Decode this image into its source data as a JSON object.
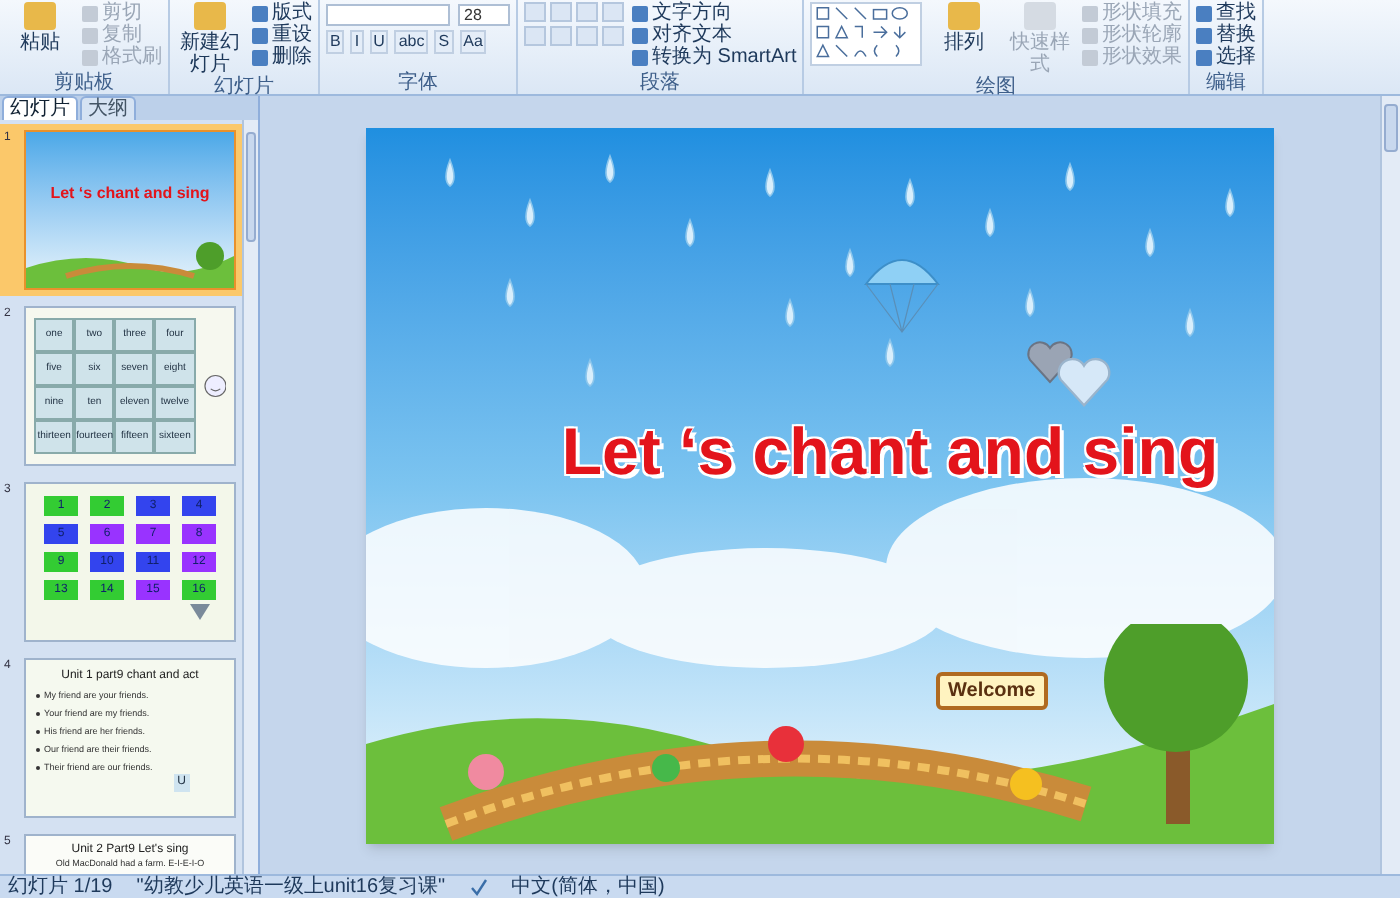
{
  "ribbon": {
    "groups": [
      {
        "name": "剪贴板",
        "kind": "clipboard",
        "big": [
          {
            "label": "粘贴",
            "disabled": false
          }
        ],
        "items": [
          {
            "label": "剪切",
            "disabled": true
          },
          {
            "label": "复制",
            "disabled": true
          },
          {
            "label": "格式刷",
            "disabled": true
          }
        ]
      },
      {
        "name": "幻灯片",
        "kind": "slides",
        "big": [
          {
            "label": "新建幻灯片",
            "disabled": false
          }
        ],
        "items": [
          {
            "label": "版式",
            "disabled": false
          },
          {
            "label": "重设",
            "disabled": false
          },
          {
            "label": "删除",
            "disabled": false
          }
        ]
      },
      {
        "name": "字体",
        "kind": "font",
        "font_size": "28",
        "buttons": [
          "B",
          "I",
          "U",
          "abc",
          "S",
          "Aa"
        ]
      },
      {
        "name": "段落",
        "kind": "paragraph",
        "items": [
          {
            "label": "文字方向",
            "disabled": false
          },
          {
            "label": "对齐文本",
            "disabled": false
          },
          {
            "label": "转换为 SmartArt",
            "disabled": false
          }
        ]
      },
      {
        "name": "绘图",
        "kind": "drawing",
        "big": [
          {
            "label": "排列",
            "disabled": false
          },
          {
            "label": "快速样式",
            "disabled": true
          }
        ],
        "items": [
          {
            "label": "形状填充",
            "disabled": true
          },
          {
            "label": "形状轮廓",
            "disabled": true
          },
          {
            "label": "形状效果",
            "disabled": true
          }
        ]
      },
      {
        "name": "编辑",
        "kind": "editing",
        "items": [
          {
            "label": "查找",
            "disabled": false
          },
          {
            "label": "替换",
            "disabled": false
          },
          {
            "label": "选择",
            "disabled": false
          }
        ]
      }
    ]
  },
  "panel_tabs": [
    {
      "label": "幻灯片",
      "selected": true
    },
    {
      "label": "大纲",
      "selected": false
    }
  ],
  "thumbnails": [
    {
      "number": "1",
      "kind": "title",
      "selected": true,
      "title": "Let ‘s chant and sing"
    },
    {
      "number": "2",
      "kind": "words",
      "selected": false,
      "words": [
        "one",
        "two",
        "three",
        "four",
        "five",
        "six",
        "seven",
        "eight",
        "nine",
        "ten",
        "eleven",
        "twelve",
        "thirteen",
        "fourteen",
        "fifteen",
        "sixteen"
      ]
    },
    {
      "number": "3",
      "kind": "tiles",
      "selected": false,
      "tiles": [
        {
          "label": "1",
          "color": "#33cc33"
        },
        {
          "label": "2",
          "color": "#33cc33"
        },
        {
          "label": "3",
          "color": "#3344ee"
        },
        {
          "label": "4",
          "color": "#3344ee"
        },
        {
          "label": "5",
          "color": "#3344ee"
        },
        {
          "label": "6",
          "color": "#9933ff"
        },
        {
          "label": "7",
          "color": "#9933ff"
        },
        {
          "label": "8",
          "color": "#9933ff"
        },
        {
          "label": "9",
          "color": "#33cc33"
        },
        {
          "label": "10",
          "color": "#3344ee"
        },
        {
          "label": "11",
          "color": "#3344ee"
        },
        {
          "label": "12",
          "color": "#9933ff"
        },
        {
          "label": "13",
          "color": "#33cc33"
        },
        {
          "label": "14",
          "color": "#33cc33"
        },
        {
          "label": "15",
          "color": "#9933ff"
        },
        {
          "label": "16",
          "color": "#33cc33"
        }
      ]
    },
    {
      "number": "4",
      "kind": "bullets",
      "selected": false,
      "title": "Unit 1 part9 chant and act",
      "bullets": [
        "My friend are your friends.",
        "Your friend are my friends.",
        "His friend are her friends.",
        "Our friend are their friends.",
        "Their friend are our friends."
      ],
      "tag": "U"
    },
    {
      "number": "5",
      "kind": "song",
      "selected": false,
      "title": "Unit 2 Part9 Let's sing",
      "line": "Old MacDonald had a farm. E-I-E-I-O"
    }
  ],
  "slide": {
    "title": "Let ‘s chant and sing",
    "sign": "Welcome"
  },
  "status_bar": {
    "slide": "幻灯片 1/19",
    "theme": "\"幼教少儿英语一级上unit16复习课\"",
    "language": "中文(简体，中国)"
  }
}
